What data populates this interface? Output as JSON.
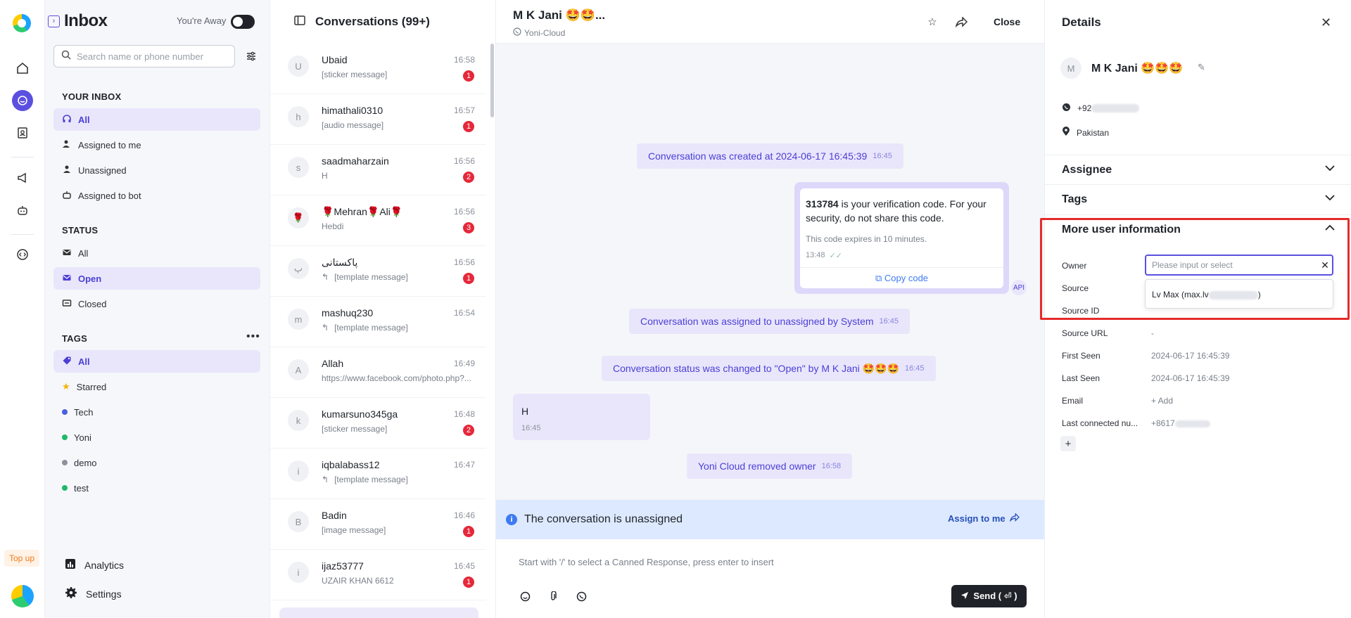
{
  "rail": {
    "top_up_label": "Top up"
  },
  "inbox": {
    "title": "Inbox",
    "away_label": "You're Away",
    "search_placeholder": "Search name or phone number",
    "your_inbox_header": "YOUR INBOX",
    "your_inbox_items": [
      "All",
      "Assigned to me",
      "Unassigned",
      "Assigned to bot"
    ],
    "status_header": "STATUS",
    "status_items": [
      "All",
      "Open",
      "Closed"
    ],
    "tags_header": "TAGS",
    "tag_items": [
      {
        "label": "All",
        "color": "#5b4fe0"
      },
      {
        "label": "Starred",
        "color": "#f5b400"
      },
      {
        "label": "Tech",
        "color": "#4b5fe0"
      },
      {
        "label": "Yoni",
        "color": "#1fb86a"
      },
      {
        "label": "demo",
        "color": "#8c919b"
      },
      {
        "label": "test",
        "color": "#1fb86a"
      }
    ],
    "analytics_label": "Analytics",
    "settings_label": "Settings"
  },
  "conversations": {
    "title": "Conversations (99+)",
    "items": [
      {
        "avatar": "U",
        "name": "Ubaid",
        "preview": "[sticker message]",
        "time": "16:58",
        "badge": "1",
        "reply": false
      },
      {
        "avatar": "h",
        "name": "himathali0310",
        "preview": "[audio message]",
        "time": "16:57",
        "badge": "1",
        "reply": false
      },
      {
        "avatar": "s",
        "name": "saadmaharzain",
        "preview": "H",
        "time": "16:56",
        "badge": "2",
        "reply": false
      },
      {
        "avatar": "🌹",
        "name": "🌹Mehran🌹Ali🌹",
        "preview": "Hebdi",
        "time": "16:56",
        "badge": "3",
        "reply": false
      },
      {
        "avatar": "پ",
        "name": "پاکستانی",
        "preview": "[template message]",
        "time": "16:56",
        "badge": "1",
        "reply": true
      },
      {
        "avatar": "m",
        "name": "mashuq230",
        "preview": "[template message]",
        "time": "16:54",
        "badge": "",
        "reply": true
      },
      {
        "avatar": "A",
        "name": "Allah",
        "preview": "https://www.facebook.com/photo.php?...",
        "time": "16:49",
        "badge": "",
        "reply": false
      },
      {
        "avatar": "k",
        "name": "kumarsuno345ga",
        "preview": "[sticker message]",
        "time": "16:48",
        "badge": "2",
        "reply": false
      },
      {
        "avatar": "i",
        "name": "iqbalabass12",
        "preview": "[template message]",
        "time": "16:47",
        "badge": "",
        "reply": true
      },
      {
        "avatar": "B",
        "name": "Badin",
        "preview": "[image message]",
        "time": "16:46",
        "badge": "1",
        "reply": false
      },
      {
        "avatar": "i",
        "name": "ijaz53777",
        "preview": "UZAIR KHAN 6612",
        "time": "16:45",
        "badge": "1",
        "reply": false
      }
    ]
  },
  "chat": {
    "contact_name": "M K Jani 🤩🤩...",
    "channel": "Yoni-Cloud",
    "close_label": "Close",
    "system_messages": [
      {
        "text": "Conversation was created at 2024-06-17 16:45:39",
        "time": "16:45"
      },
      {
        "text": "Conversation was assigned to unassigned by System",
        "time": "16:45"
      },
      {
        "text": "Conversation status was changed to \"Open\" by M K Jani 🤩🤩🤩",
        "time": "16:45"
      },
      {
        "text": "Yoni Cloud removed owner",
        "time": "16:58"
      }
    ],
    "template": {
      "code": "313784",
      "body": " is your verification code. For your security, do not share this code.",
      "footer": "This code expires in 10 minutes.",
      "time": "13:48",
      "copy_label": "Copy code",
      "api_badge": "API"
    },
    "incoming": {
      "text": "H",
      "time": "16:45"
    },
    "unassigned_text": "The conversation is unassigned",
    "assign_label": "Assign to me",
    "composer_placeholder": "Start with '/' to select a Canned Response, press enter to insert",
    "send_label": "Send ( ⏎ )"
  },
  "details": {
    "title": "Details",
    "avatar": "M",
    "name": "M K Jani 🤩🤩🤩",
    "phone_prefix": "+92",
    "country": "Pakistan",
    "sections": [
      "Assignee",
      "Tags",
      "More user information"
    ],
    "owner_label": "Owner",
    "owner_placeholder": "Please input or select",
    "owner_option": "Lv Max (max.lv",
    "fields": [
      {
        "key": "Source",
        "value": ""
      },
      {
        "key": "Source ID",
        "value": ""
      },
      {
        "key": "Source URL",
        "value": "-"
      },
      {
        "key": "First Seen",
        "value": "2024-06-17 16:45:39"
      },
      {
        "key": "Last Seen",
        "value": "2024-06-17 16:45:39"
      },
      {
        "key": "Email",
        "value": "+ Add"
      },
      {
        "key": "Last connected nu...",
        "value": "+8617"
      }
    ]
  }
}
